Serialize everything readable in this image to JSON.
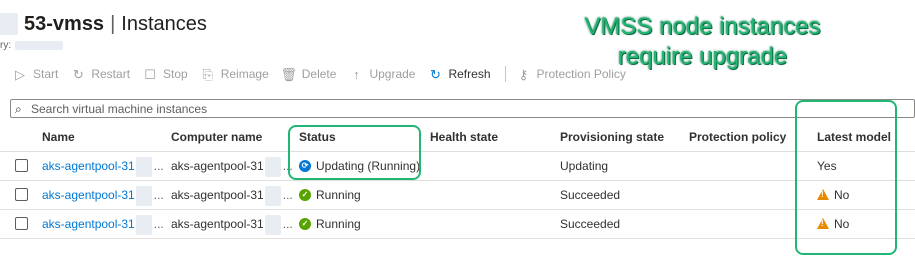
{
  "header": {
    "name": "53-vmss",
    "separator": "|",
    "page": "Instances",
    "subtitle_prefix": "ry:"
  },
  "toolbar": {
    "items": [
      {
        "label": "Start",
        "icon": "play-icon",
        "enabled": false
      },
      {
        "label": "Restart",
        "icon": "restart-icon",
        "enabled": false
      },
      {
        "label": "Stop",
        "icon": "stop-icon",
        "enabled": false
      },
      {
        "label": "Reimage",
        "icon": "reimage-icon",
        "enabled": false
      },
      {
        "label": "Delete",
        "icon": "trash-icon",
        "enabled": false
      },
      {
        "label": "Upgrade",
        "icon": "arrow-up-icon",
        "enabled": false
      },
      {
        "label": "Refresh",
        "icon": "refresh-icon",
        "enabled": true
      },
      {
        "label": "Protection Policy",
        "icon": "key-icon",
        "enabled": false
      }
    ]
  },
  "callout": {
    "line1": "VMSS node instances",
    "line2": "require upgrade",
    "color": "#22b573"
  },
  "search": {
    "placeholder": "Search virtual machine instances",
    "value": ""
  },
  "table": {
    "columns": {
      "name": "Name",
      "computer": "Computer name",
      "status": "Status",
      "health": "Health state",
      "provisioning": "Provisioning state",
      "protection": "Protection policy",
      "latest": "Latest model"
    },
    "rows": [
      {
        "name": "aks-agentpool-31",
        "name_suffix": "...",
        "computer": "aks-agentpool-31",
        "computer_suffix": "...",
        "status": "Updating (Running)",
        "status_icon": "sync-icon",
        "health": "",
        "provisioning": "Updating",
        "protection": "",
        "latest": "Yes",
        "latest_warning": false
      },
      {
        "name": "aks-agentpool-31",
        "name_suffix": "...",
        "computer": "aks-agentpool-31",
        "computer_suffix": "...",
        "status": "Running",
        "status_icon": "check-circle-icon",
        "health": "",
        "provisioning": "Succeeded",
        "protection": "",
        "latest": "No",
        "latest_warning": true
      },
      {
        "name": "aks-agentpool-31",
        "name_suffix": "...",
        "computer": "aks-agentpool-31",
        "computer_suffix": "...",
        "status": "Running",
        "status_icon": "check-circle-icon",
        "health": "",
        "provisioning": "Succeeded",
        "protection": "",
        "latest": "No",
        "latest_warning": true
      }
    ]
  }
}
